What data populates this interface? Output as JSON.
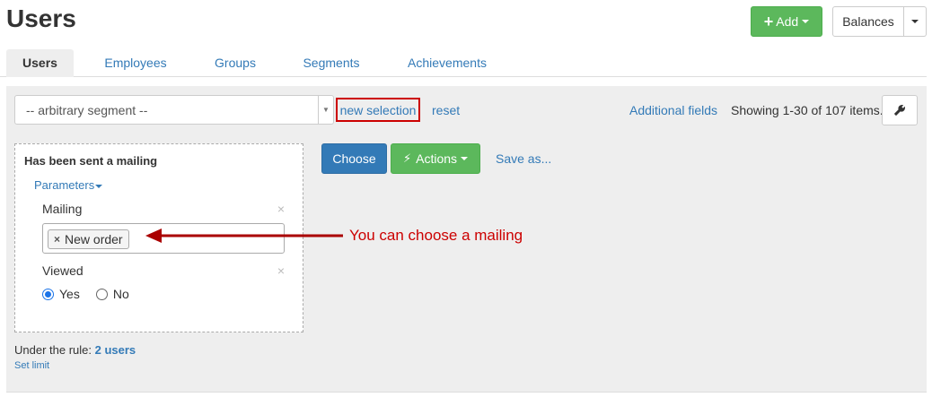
{
  "header": {
    "title": "Users",
    "add_label": "Add",
    "balances_label": "Balances"
  },
  "tabs": [
    {
      "label": "Users",
      "active": true
    },
    {
      "label": "Employees",
      "active": false
    },
    {
      "label": "Groups",
      "active": false
    },
    {
      "label": "Segments",
      "active": false
    },
    {
      "label": "Achievements",
      "active": false
    }
  ],
  "toolbar": {
    "segment_value": "-- arbitrary segment --",
    "new_selection_label": "new selection",
    "reset_label": "reset",
    "additional_fields_label": "Additional fields",
    "showing_text": "Showing 1-30 of 107 items."
  },
  "filter": {
    "title": "Has been sent a mailing",
    "parameters_label": "Parameters",
    "mailing_label": "Mailing",
    "mailing_tag": "New order",
    "viewed_label": "Viewed",
    "yes_label": "Yes",
    "no_label": "No",
    "viewed_selected": "Yes"
  },
  "actions": {
    "choose_label": "Choose",
    "actions_label": "Actions",
    "save_as_label": "Save as..."
  },
  "rule": {
    "prefix": "Under the rule:",
    "count": "2 users",
    "set_limit_label": "Set limit"
  },
  "annotation": {
    "text": "You can choose a mailing"
  },
  "colors": {
    "primary": "#337ab7",
    "success": "#5cb85c",
    "annotation": "#cc0000"
  }
}
